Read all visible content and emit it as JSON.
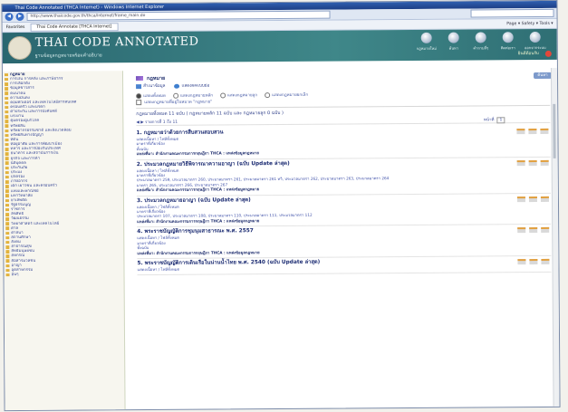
{
  "window": {
    "title": "Thai Code Annotated (THCA Internet) - Windows Internet Explorer",
    "url": "http://www.thaicode.gov.th/thca/internet/frame_main.do",
    "tab": "Thai Code Annotate [THCA Internet]",
    "favorites": "Favorites",
    "ie_tools": "Page ▾  Safety ▾  Tools ▾"
  },
  "header": {
    "brand": "THAI CODE ANNOTATED",
    "subtitle": "ฐานข้อมูลกฎหมายพร้อมคำอธิบาย",
    "nav": [
      "กฎหมายใหม่",
      "ค้นหา",
      "คำถามถี่ๆ",
      "ติดต่อเรา",
      "ออกจากระบบ"
    ],
    "user": "ยินดีต้อนรับ"
  },
  "sidebar": {
    "items": [
      "กฎหมาย",
      "การเงิน การคลัง และภาษีอากร",
      "การเลือกตั้ง",
      "ข้อมูลข่าวสาร",
      "คมนาคม",
      "ความมั่นคง",
      "คอมพิวเตอร์ และเทคโนโลยีสารสนเทศ",
      "ครอบครัว และมรดก",
      "ค้ำประกัน และการบังคับคดี",
      "แรงงาน",
      "คุ้มครองผู้บริโภค",
      "ทรัพย์สิน",
      "ทรัพยากรธรรมชาติ และสิ่งแวดล้อม",
      "ทรัพย์สินทางปัญญา",
      "ที่ดิน",
      "ที่อยู่อาศัย และการพัฒนาเมือง",
      "ทหาร และการป้องกันประเทศ",
      "ธนาคาร และสถาบันการเงิน",
      "ธุรกิจ และการค้า",
      "นิติบุคคล",
      "ประกันภัย",
      "ประมง",
      "ปกครอง",
      "ภาษีอากร",
      "เด็ก เยาวชน และครอบครัว",
      "แพ่งและพาณิชย์",
      "มหาวิทยาลัย",
      "ยาเสพติด",
      "รัฐธรรมนูญ",
      "ราชการ",
      "ลิขสิทธิ์",
      "วัฒนธรรม",
      "วิทยาศาสตร์ และเทคโนโลยี",
      "ศาล",
      "ศาสนา",
      "สถานศึกษา",
      "สังคม",
      "สาธารณสุข",
      "สิทธิมนุษยชน",
      "สหกรณ์",
      "สื่อสารมวลชน",
      "อาญา",
      "อุตสาหกรรม",
      "อื่นๆ"
    ]
  },
  "content": {
    "breadcrumb": "กฎหมาย",
    "go_button": "ค้นหา",
    "tools": [
      "สำเนาข้อมูล",
      "แสดงผลแบบย่อ"
    ],
    "radios": [
      {
        "label": "แสดงทั้งหมด",
        "selected": true
      },
      {
        "label": "แสดงกฎหมายหลัก",
        "selected": false
      },
      {
        "label": "แสดงกฎหมายลูก",
        "selected": false
      },
      {
        "label": "แสดงกฎหมายยกเลิก",
        "selected": false
      }
    ],
    "checkbox": "แสดงกฎหมายที่อยู่ในหมวด \"กฎหมาย\"",
    "found": "กฎหมายทั้งหมด 11 ฉบับ ( กฎหมายหลัก 11 ฉบับ และ กฎหมายลูก 0 ฉบับ )",
    "pager": {
      "left": "รายการที่ 1 ถึง 11",
      "right": "หน้าที่",
      "page": "1"
    },
    "results": [
      {
        "title": "1. กฎหมายว่าด้วยการสืบสวนสอบสวน",
        "lines": [
          "แสดงเนื้อหา / ไฟล์ทั้งหมด",
          "มาตราที่เกี่ยวข้อง",
          "ทั้งฉบับ"
        ],
        "source": "แหล่งที่มา: สำนักงานคณะกรรมการกฤษฎีกา THCA : แหล่งข้อมูลกฎหมาย"
      },
      {
        "title": "2. ประมวลกฎหมายวิธีพิจารณาความอาญา (ฉบับ Update ล่าสุด)",
        "lines": [
          "แสดงเนื้อหา / ไฟล์ทั้งหมด",
          "มาตราที่เกี่ยวข้อง",
          "ประมวลมาตรา 259, ประมวลมาตรา 260, ประมวลมาตรา 261, ประมวลมาตรา 261 ทวิ, ประมวลมาตรา 262, ประมวลมาตรา 263, ประมวลมาตรา 264",
          "มาตรา 265, ประมวลมาตรา 266, ประมวลมาตรา 267"
        ],
        "source": "แหล่งที่มา: สำนักงานคณะกรรมการกฤษฎีกา THCA : แหล่งข้อมูลกฎหมาย"
      },
      {
        "title": "3. ประมวลกฎหมายอาญา (ฉบับ Update ล่าสุด)",
        "lines": [
          "แสดงเนื้อหา / ไฟล์ทั้งหมด",
          "มาตราที่เกี่ยวข้อง",
          "ประมวลมาตรา 107, ประมวลมาตรา 108, ประมวลมาตรา 110, ประมวลมาตรา 111, ประมวลมาตรา 112"
        ],
        "source": "แหล่งที่มา: สำนักงานคณะกรรมการกฤษฎีกา THCA : แหล่งข้อมูลกฎหมาย"
      },
      {
        "title": "4. พระราชบัญญัติการชุมนุมสาธารณะ พ.ศ. 2557",
        "lines": [
          "แสดงเนื้อหา / ไฟล์ทั้งหมด",
          "มาตราที่เกี่ยวข้อง",
          "ทั้งฉบับ"
        ],
        "source": "แหล่งที่มา: สำนักงานคณะกรรมการกฤษฎีกา THCA : แหล่งข้อมูลกฎหมาย"
      },
      {
        "title": "5. พระราชบัญญัติการเดินเรือในน่านน้ำไทย พ.ศ. 2540 (ฉบับ Update ล่าสุด)",
        "lines": [
          "แสดงเนื้อหา / ไฟล์ทั้งหมด"
        ],
        "source": ""
      }
    ]
  },
  "colors": {
    "banner": "#3f8789",
    "link": "#3d4fa8",
    "title": "#1b2b72",
    "accent": "#e2a03f"
  }
}
